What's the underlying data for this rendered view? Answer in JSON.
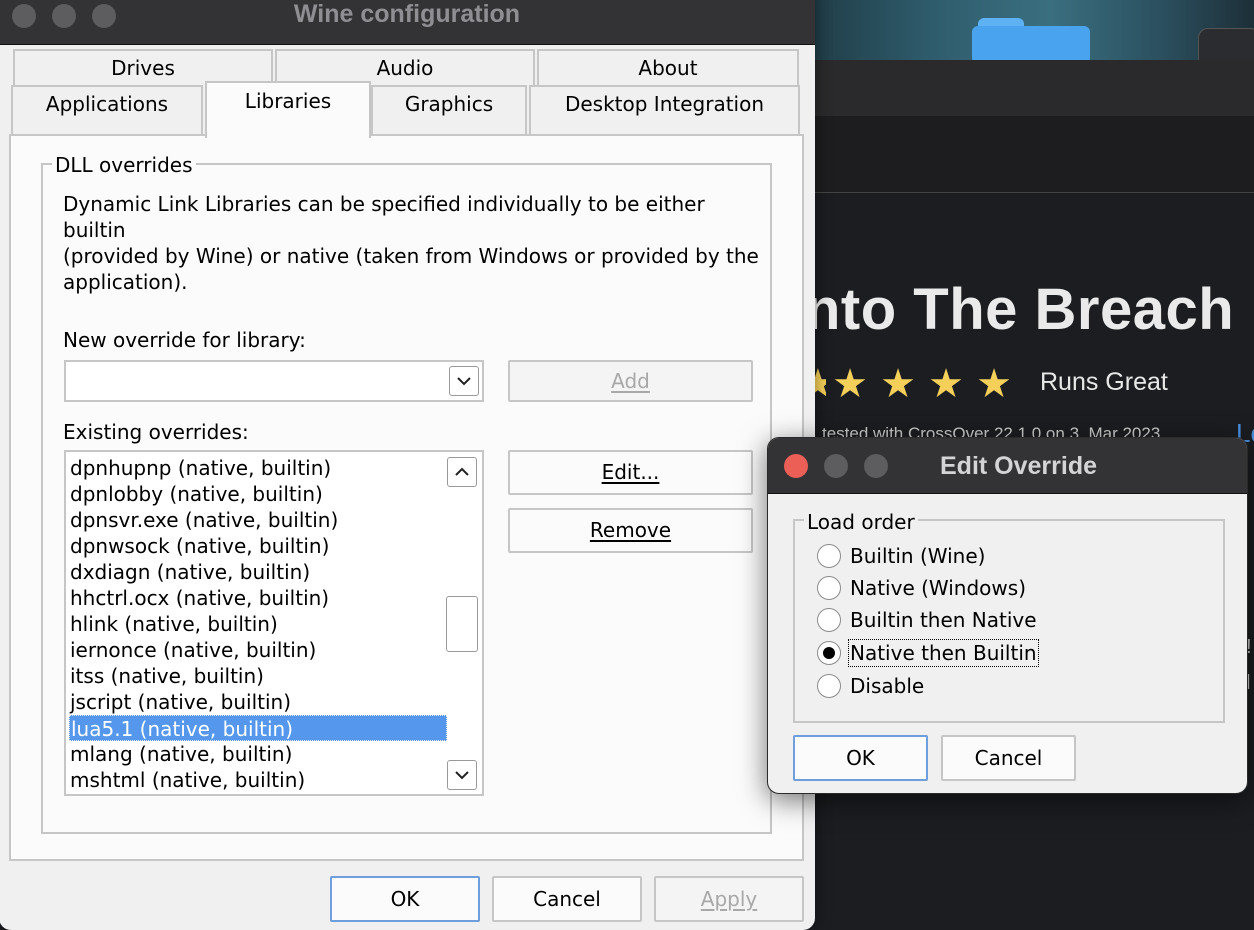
{
  "background_app": {
    "game_title": "nto The Breach",
    "stars": [
      "★",
      "★",
      "★",
      "★",
      "★"
    ],
    "rating": "Runs Great",
    "tested": "tested with CrossOver 22.1.0 on 3, Mar 2023",
    "link_glyph": "Lo",
    "edge_glyphs": [
      "!",
      "l"
    ]
  },
  "wine_window": {
    "title": "Wine configuration",
    "tabs_row1": [
      "Drives",
      "Audio",
      "About"
    ],
    "tabs_row2": [
      "Applications",
      "Libraries",
      "Graphics",
      "Desktop Integration"
    ],
    "active_tab": "Libraries",
    "group_title": "DLL overrides",
    "description_lines": [
      "Dynamic Link Libraries can be specified individually to be either builtin",
      "(provided by Wine) or native (taken from Windows or provided by the",
      "application)."
    ],
    "new_override_label": "New override for library:",
    "new_override_value": "",
    "add_button": "Add",
    "existing_label": "Existing overrides:",
    "overrides": [
      "dpnhupnp (native, builtin)",
      "dpnlobby (native, builtin)",
      "dpnsvr.exe (native, builtin)",
      "dpnwsock (native, builtin)",
      "dxdiagn (native, builtin)",
      "hhctrl.ocx (native, builtin)",
      "hlink (native, builtin)",
      "iernonce (native, builtin)",
      "itss (native, builtin)",
      "jscript (native, builtin)",
      "lua5.1 (native, builtin)",
      "mlang (native, builtin)",
      "mshtml (native, builtin)"
    ],
    "selected_override": "lua5.1 (native, builtin)",
    "edit_button": "Edit...",
    "remove_button": "Remove",
    "ok_button": "OK",
    "cancel_button": "Cancel",
    "apply_button": "Apply"
  },
  "edit_override": {
    "title": "Edit Override",
    "group_title": "Load order",
    "options": [
      "Builtin (Wine)",
      "Native (Windows)",
      "Builtin then Native",
      "Native then Builtin",
      "Disable"
    ],
    "selected_option": "Native then Builtin",
    "ok_button": "OK",
    "cancel_button": "Cancel"
  },
  "colors": {
    "selection": "#5597ec",
    "titlebar": "#333336",
    "close_red": "#ec5f57",
    "star_yellow": "#f4cf5a",
    "link_blue": "#4a90e2"
  }
}
